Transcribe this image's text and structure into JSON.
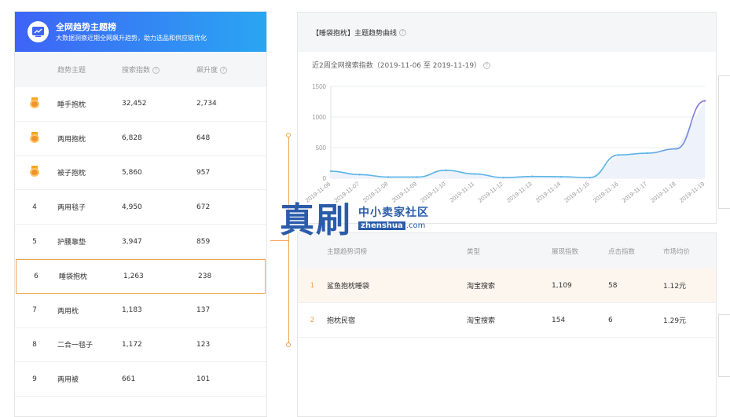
{
  "left_panel": {
    "title": "全网趋势主题榜",
    "subtitle": "大数据洞察近期全网飙升趋势，助力选品和供应链优化",
    "columns": {
      "theme": "趋势主题",
      "search": "搜索指数",
      "rise": "飙升度"
    },
    "rows": [
      {
        "rank": "1",
        "theme": "睡手抱枕",
        "search": "32,452",
        "rise": "2,734",
        "medal": true
      },
      {
        "rank": "2",
        "theme": "两用抱枕",
        "search": "6,828",
        "rise": "648",
        "medal": true
      },
      {
        "rank": "3",
        "theme": "被子抱枕",
        "search": "5,860",
        "rise": "957",
        "medal": true
      },
      {
        "rank": "4",
        "theme": "两用毯子",
        "search": "4,950",
        "rise": "672",
        "medal": false
      },
      {
        "rank": "5",
        "theme": "护腰靠垫",
        "search": "3,947",
        "rise": "859",
        "medal": false
      },
      {
        "rank": "6",
        "theme": "睡袋抱枕",
        "search": "1,263",
        "rise": "238",
        "medal": false,
        "selected": true
      },
      {
        "rank": "7",
        "theme": "两用枕",
        "search": "1,183",
        "rise": "137",
        "medal": false
      },
      {
        "rank": "8",
        "theme": "二合一毯子",
        "search": "1,172",
        "rise": "123",
        "medal": false
      },
      {
        "rank": "9",
        "theme": "两用被",
        "search": "661",
        "rise": "101",
        "medal": false
      }
    ]
  },
  "trend_card": {
    "title": "【睡袋抱枕】主题趋势曲线",
    "subtitle": "近2周全网搜索指数（2019-11-06 至 2019-11-19）"
  },
  "chart_data": {
    "type": "area",
    "x": [
      "2019-11-06",
      "2019-11-07",
      "2019-11-08",
      "2019-11-09",
      "2019-11-10",
      "2019-11-11",
      "2019-11-12",
      "2019-11-13",
      "2019-11-14",
      "2019-11-15",
      "2019-11-16",
      "2019-11-17",
      "2019-11-18",
      "2019-11-19"
    ],
    "values": [
      115,
      60,
      20,
      20,
      130,
      70,
      10,
      30,
      25,
      10,
      380,
      410,
      480,
      1263
    ],
    "ylim": [
      0,
      1500
    ],
    "yticks": [
      "0",
      "500",
      "1000",
      "1500"
    ],
    "line_color": "#5ab5e8",
    "line_color_end": "#8a6fd8",
    "fill_color": "#eef3fb",
    "grid": true
  },
  "detail_table": {
    "columns": {
      "keyword": "主题趋势词榜",
      "type": "类型",
      "show": "展现指数",
      "click": "点击指数",
      "price": "市场均价"
    },
    "rows": [
      {
        "idx": "1",
        "keyword": "鲨鱼抱枕睡袋",
        "type": "淘宝搜索",
        "show": "1,109",
        "click": "58",
        "price": "1.12元"
      },
      {
        "idx": "2",
        "keyword": "抱枕民宿",
        "type": "淘宝搜索",
        "show": "154",
        "click": "6",
        "price": "1.29元"
      }
    ]
  },
  "watermark": {
    "big": "真刷",
    "cn": "中小卖家社区",
    "en_box": "zhenshua",
    "en_dom": ".com"
  },
  "colors": {
    "accent_orange": "#f2a24b",
    "header_blue_start": "#3e63f6",
    "header_blue_end": "#2aa6f2"
  }
}
